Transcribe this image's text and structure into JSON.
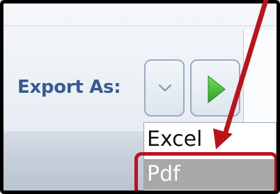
{
  "toolbar": {
    "export_label": "Export As:",
    "dropdown_icon": "chevron-down-icon",
    "go_icon": "play-arrow-icon"
  },
  "menu": {
    "items": [
      {
        "label": "Excel"
      },
      {
        "label": "Pdf",
        "highlighted": true
      }
    ]
  },
  "annotation": {
    "arrow_icon": "arrow-icon",
    "color": "#b8141d"
  },
  "colors": {
    "label_text": "#3a5b8f",
    "go_arrow": "#3fbf3a",
    "selected_item_bg": "#a8a8a8"
  }
}
